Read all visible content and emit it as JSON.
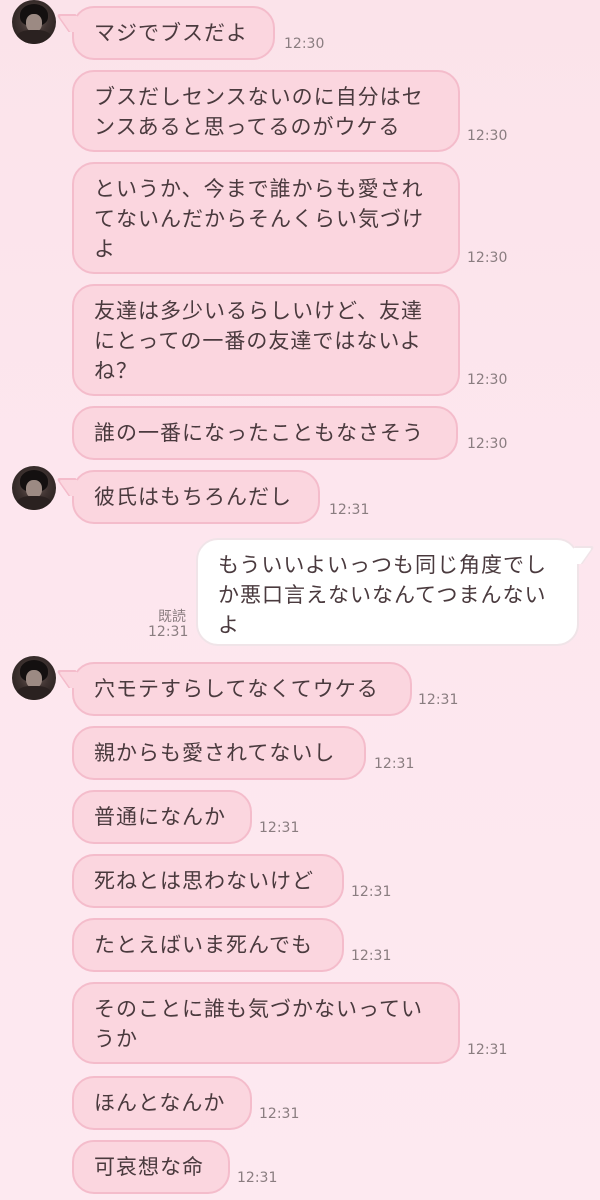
{
  "messages": [
    {
      "text": "マジでブスだよ",
      "time": "12:30"
    },
    {
      "text": "ブスだしセンスないのに自分はセ\nンスあると思ってるのがウケる",
      "time": "12:30"
    },
    {
      "text": "というか、今まで誰からも愛され\nてないんだからそんくらい気づけ\nよ",
      "time": "12:30"
    },
    {
      "text": "友達は多少いるらしいけど、友達\nにとっての一番の友達ではないよ\nね？",
      "time": "12:30"
    },
    {
      "text": "誰の一番になったこともなさそう",
      "time": "12:30"
    },
    {
      "text": "彼氏はもちろんだし",
      "time": "12:31"
    },
    {
      "text": "もういいよいっつも同じ角度でし\nか悪口言えないなんてつまんない\nよ",
      "time": "12:31",
      "read": "既読"
    },
    {
      "text": "穴モテすらしてなくてウケる",
      "time": "12:31"
    },
    {
      "text": "親からも愛されてないし",
      "time": "12:31"
    },
    {
      "text": "普通になんか",
      "time": "12:31"
    },
    {
      "text": "死ねとは思わないけど",
      "time": "12:31"
    },
    {
      "text": "たとえばいま死んでも",
      "time": "12:31"
    },
    {
      "text": "そのことに誰も気づかないってい\nうか",
      "time": "12:31"
    },
    {
      "text": "ほんとなんか",
      "time": "12:31"
    },
    {
      "text": "可哀想な命",
      "time": "12:31"
    }
  ],
  "colors": {
    "incoming_bubble": "#fbd6df",
    "outgoing_bubble": "#ffffff",
    "background": "#fde6ee"
  }
}
